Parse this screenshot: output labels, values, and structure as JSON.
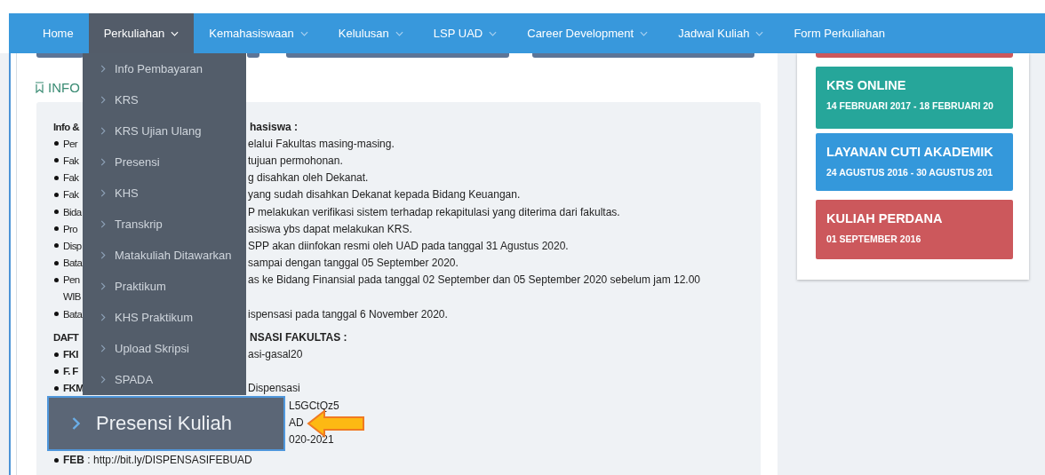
{
  "nav": [
    {
      "label": "Home",
      "dropdown": false,
      "selected": false
    },
    {
      "label": "Perkuliahan",
      "dropdown": true,
      "selected": true
    },
    {
      "label": "Kemahasiswaan",
      "dropdown": true,
      "selected": false
    },
    {
      "label": "Kelulusan",
      "dropdown": true,
      "selected": false
    },
    {
      "label": "LSP UAD",
      "dropdown": true,
      "selected": false
    },
    {
      "label": "Career Development",
      "dropdown": true,
      "selected": false
    },
    {
      "label": "Jadwal Kuliah",
      "dropdown": true,
      "selected": false
    },
    {
      "label": "Form Perkuliahan",
      "dropdown": false,
      "selected": false
    }
  ],
  "dropdown_menu": [
    "Info Pembayaran",
    "KRS",
    "KRS Ujian Ulang",
    "Presensi",
    "KHS",
    "Transkrip",
    "Matakuliah Ditawarkan",
    "Praktikum",
    "KHS Praktikum",
    "Upload Skripsi",
    "SPADA"
  ],
  "callout": {
    "label": "Presensi Kuliah"
  },
  "info": {
    "heading": "INFO",
    "lines": [
      {
        "kind": "heading",
        "lead": "Info &",
        "rest": "hasiswa :"
      },
      {
        "kind": "bullet",
        "lead": "Per",
        "rest": "elalui Fakultas masing-masing."
      },
      {
        "kind": "bullet",
        "lead": "Fak",
        "rest": "tujuan permohonan."
      },
      {
        "kind": "bullet",
        "lead": "Fak",
        "rest": "g disahkan oleh Dekanat."
      },
      {
        "kind": "bullet",
        "lead": "Fak",
        "rest": "yang sudah disahkan Dekanat kepada Bidang Keuangan."
      },
      {
        "kind": "bullet",
        "lead": "Bida",
        "rest": "P melakukan verifikasi sistem terhadap rekapitulasi yang diterima dari fakultas."
      },
      {
        "kind": "bullet",
        "lead": "Pro",
        "rest": "asiswa ybs dapat melakukan KRS."
      },
      {
        "kind": "bullet",
        "lead": "Disp",
        "rest": "SPP akan diinfokan resmi oleh UAD pada tanggal 31 Agustus 2020."
      },
      {
        "kind": "bullet",
        "lead": "Bata",
        "rest": "sampai dengan tanggal 05 September 2020."
      },
      {
        "kind": "bullet",
        "lead": "Pen",
        "rest": "as ke Bidang Finansial pada tanggal 02 September dan 05 September 2020 sebelum jam 12.00"
      },
      {
        "kind": "continued",
        "lead": "WIB"
      },
      {
        "kind": "bullet",
        "lead": "Bata",
        "rest": "ispensasi pada tanggal 6 November 2020."
      },
      {
        "kind": "heading",
        "lead": "DAFT",
        "rest": "NSASI FAKULTAS :"
      },
      {
        "kind": "bullet",
        "lead": "FKI",
        "bold_lead": true,
        "rest": "asi-gasal20"
      },
      {
        "kind": "bullet",
        "lead": "F. F",
        "bold_lead": true
      },
      {
        "kind": "bullet",
        "lead": "FKM",
        "bold_lead": true,
        "rest": "Dispensasi"
      },
      {
        "kind": "covered",
        "rest": "L5GCtQz5"
      },
      {
        "kind": "covered",
        "rest": "AD"
      },
      {
        "kind": "covered",
        "rest": "020-2021"
      },
      {
        "kind": "full",
        "text": "**FEB** : http://bit.ly/DISPENSASIFEBUAD"
      }
    ]
  },
  "sidebar": [
    {
      "title": "KRS ONLINE",
      "dates": "14 FEBRUARI 2017 - 18 FEBRUARI 20",
      "color": "#26a69a"
    },
    {
      "title": "LAYANAN CUTI AKADEMIK",
      "dates": "24 AGUSTUS 2016 - 30 AGUSTUS 201",
      "color": "#3498db"
    },
    {
      "title": "KULIAH PERDANA",
      "dates": "01 SEPTEMBER 2016",
      "color": "#cc585c"
    }
  ]
}
